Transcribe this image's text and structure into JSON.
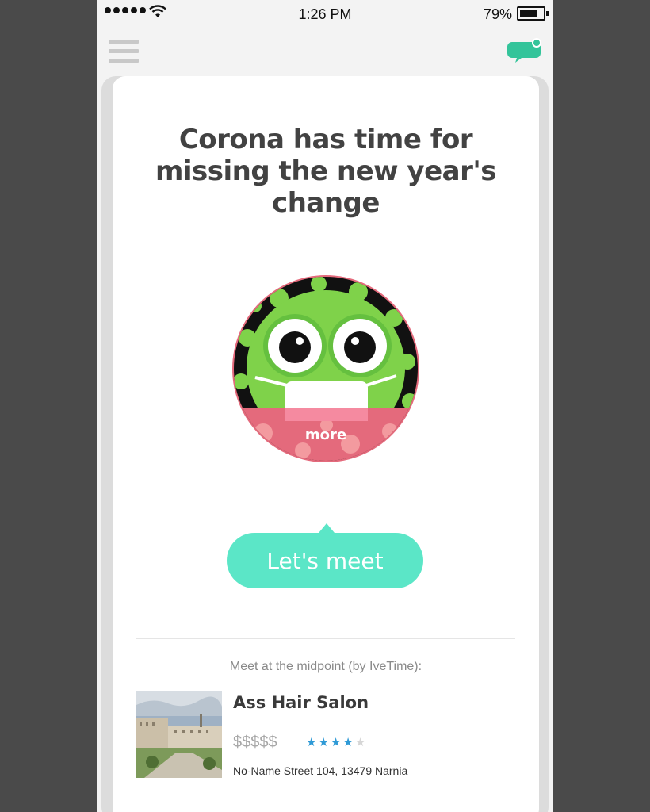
{
  "status_bar": {
    "time": "1:26 PM",
    "battery": "79%",
    "battery_level": 0.79,
    "signal_icon": "signal-dots-icon",
    "wifi_icon": "wifi-icon"
  },
  "nav": {
    "menu_icon": "hamburger-menu-icon",
    "chat_icon": "chat-bubble-icon",
    "accent_color": "#33c49a"
  },
  "card": {
    "title": "Corona has time for missing the new year's change",
    "avatar_label": "more",
    "cta": "Let's meet",
    "cta_color": "#5be6c7"
  },
  "venue": {
    "section_label": "Meet at the midpoint (by IveTime):",
    "name": "Ass Hair Salon",
    "price": "$$$$$",
    "rating": 4,
    "rating_max": 5,
    "address": "No-Name Street 104, 13479 Narnia",
    "star_color": "#2f9ad6"
  }
}
